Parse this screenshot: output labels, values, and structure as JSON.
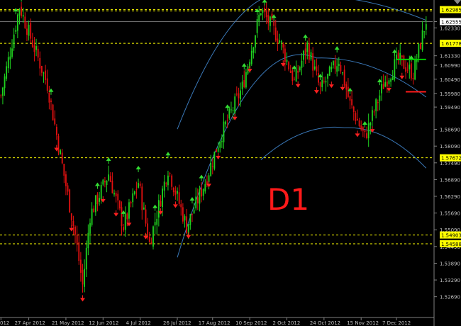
{
  "chart_data": {
    "type": "candlestick",
    "timeframe_label": "D1",
    "y_axis": {
      "min": 1.5197,
      "max": 1.6333,
      "ticks": [
        "1.62555",
        "1.62330",
        "1.61330",
        "1.60990",
        "1.60490",
        "1.59980",
        "1.59490",
        "1.58690",
        "1.58090",
        "1.57490",
        "1.56890",
        "1.56290",
        "1.55690",
        "1.55090",
        "1.54490",
        "1.53890",
        "1.53290",
        "1.52690"
      ],
      "tick_values": [
        1.62555,
        1.6233,
        1.6133,
        1.6099,
        1.6049,
        1.5998,
        1.5949,
        1.5869,
        1.5809,
        1.5749,
        1.5689,
        1.5629,
        1.5569,
        1.5509,
        1.5449,
        1.5389,
        1.5329,
        1.5269
      ]
    },
    "x_axis": {
      "labels": [
        "012",
        "27 Apr 2012",
        "21 May 2012",
        "12 Jun 2012",
        "4 Jul 2012",
        "26 Jul 2012",
        "17 Aug 2012",
        "10 Sep 2012",
        "2 Oct 2012",
        "24 Oct 2012",
        "15 Nov 2012",
        "7 Dec 2012"
      ],
      "label_bar_index": [
        0,
        15,
        35,
        55,
        75,
        95,
        114,
        134,
        154,
        174,
        194,
        213
      ]
    },
    "bar_count": 230,
    "price_anchors": [
      {
        "bar": 0,
        "price": 1.599
      },
      {
        "bar": 10,
        "price": 1.631
      },
      {
        "bar": 25,
        "price": 1.603
      },
      {
        "bar": 33,
        "price": 1.574
      },
      {
        "bar": 40,
        "price": 1.549
      },
      {
        "bar": 44,
        "price": 1.531
      },
      {
        "bar": 48,
        "price": 1.556
      },
      {
        "bar": 58,
        "price": 1.571
      },
      {
        "bar": 66,
        "price": 1.552
      },
      {
        "bar": 74,
        "price": 1.568
      },
      {
        "bar": 80,
        "price": 1.546
      },
      {
        "bar": 90,
        "price": 1.573
      },
      {
        "bar": 100,
        "price": 1.552
      },
      {
        "bar": 110,
        "price": 1.568
      },
      {
        "bar": 118,
        "price": 1.584
      },
      {
        "bar": 130,
        "price": 1.602
      },
      {
        "bar": 140,
        "price": 1.63
      },
      {
        "bar": 150,
        "price": 1.619
      },
      {
        "bar": 158,
        "price": 1.604
      },
      {
        "bar": 165,
        "price": 1.617
      },
      {
        "bar": 172,
        "price": 1.601
      },
      {
        "bar": 182,
        "price": 1.612
      },
      {
        "bar": 188,
        "price": 1.596
      },
      {
        "bar": 196,
        "price": 1.584
      },
      {
        "bar": 206,
        "price": 1.603
      },
      {
        "bar": 214,
        "price": 1.612
      },
      {
        "bar": 222,
        "price": 1.607
      },
      {
        "bar": 229,
        "price": 1.626
      }
    ],
    "horizontal_levels": [
      {
        "price": 1.62985,
        "label": "1.62985",
        "style": "dashed",
        "color": "#ffff00"
      },
      {
        "price": 1.6294,
        "label": "",
        "style": "dashed",
        "color": "#ffff00"
      },
      {
        "price": 1.61778,
        "label": "1.61778",
        "style": "dashed",
        "color": "#ffff00"
      },
      {
        "price": 1.57672,
        "label": "1.57672",
        "style": "dashed",
        "color": "#ffff00"
      },
      {
        "price": 1.54903,
        "label": "1.54903",
        "style": "dashed",
        "color": "#ffff00"
      },
      {
        "price": 1.54588,
        "label": "1.54588",
        "style": "dashed",
        "color": "#ffff00"
      }
    ],
    "current_price": {
      "price": 1.62555,
      "label": "1.62555",
      "color": "#ffffff"
    },
    "up_arrow_bars": [
      8,
      11,
      27,
      52,
      58,
      66,
      74,
      83,
      90,
      103,
      108,
      122,
      131,
      138,
      142,
      147,
      158,
      164,
      172,
      181,
      188,
      196,
      204,
      212,
      221
    ],
    "down_arrow_bars": [
      30,
      38,
      44,
      55,
      62,
      69,
      78,
      86,
      94,
      101,
      112,
      117,
      126,
      134,
      152,
      160,
      170,
      178,
      184,
      192,
      200,
      209,
      216
    ],
    "arcs": [
      {
        "from_bar": 95,
        "to_bar": 229,
        "peak_bar": 160,
        "start_price": 1.587,
        "peak_price": 1.635,
        "end_price": 1.626
      },
      {
        "from_bar": 95,
        "to_bar": 229,
        "peak_bar": 170,
        "start_price": 1.541,
        "peak_price": 1.6125,
        "end_price": 1.5985
      },
      {
        "from_bar": 140,
        "to_bar": 229,
        "peak_bar": 185,
        "start_price": 1.576,
        "peak_price": 1.5875,
        "end_price": 1.573
      }
    ],
    "short_lines": [
      {
        "bar_from": 213,
        "bar_to": 229,
        "price": 1.612,
        "color": "#00cc00"
      },
      {
        "bar_from": 218,
        "bar_to": 229,
        "price": 1.6004,
        "color": "#ff1a1a"
      }
    ],
    "colors": {
      "background": "#000000",
      "bull": "#1fd21f",
      "bear": "#e01010",
      "up_arrow": "#33dd33",
      "down_arrow": "#ff2020",
      "arc": "#3a78b8",
      "level": "#ffff00",
      "label_text": "#ffffff",
      "axis_text": "#c0c0c0",
      "big_label": "#ff1a1a"
    }
  }
}
